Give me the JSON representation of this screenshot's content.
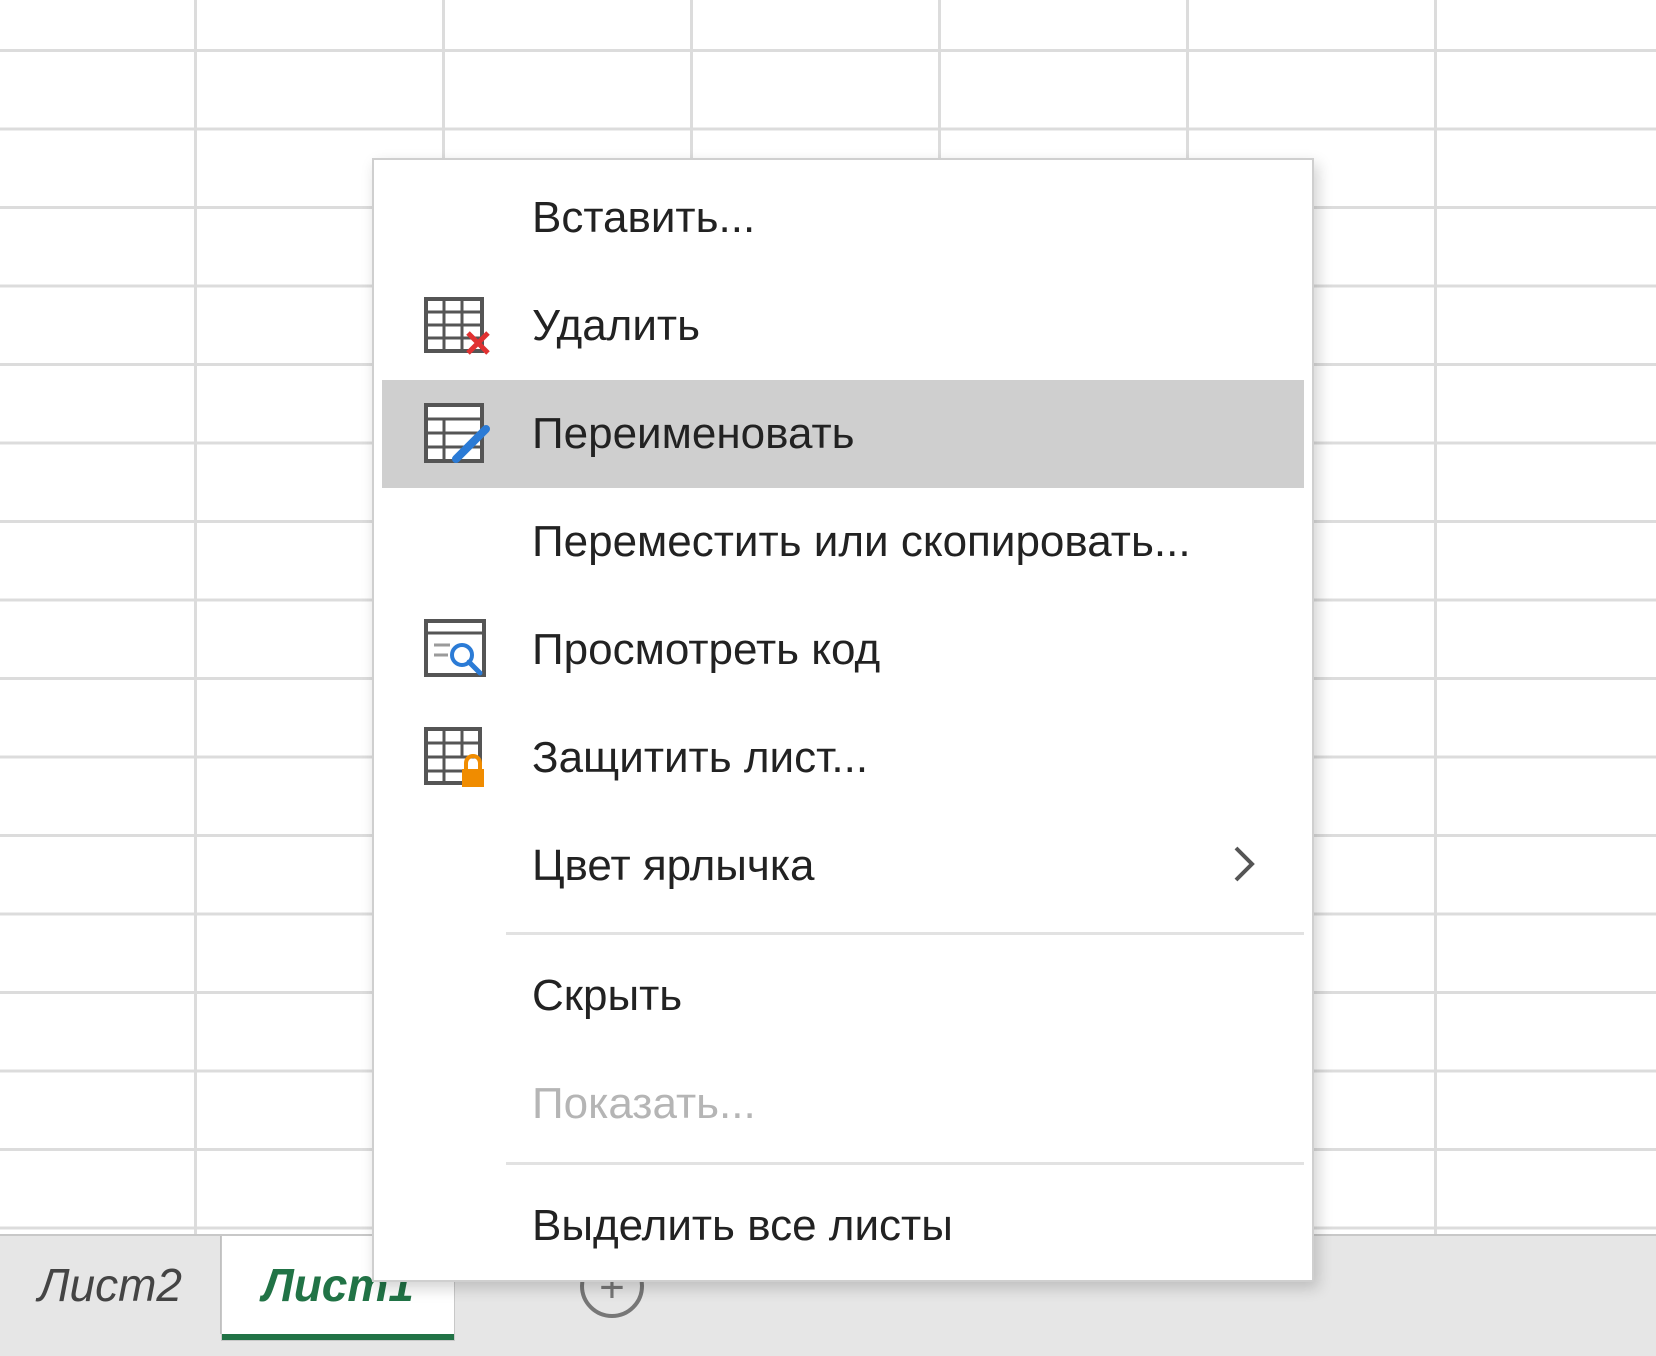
{
  "sheet_tabs": {
    "inactive_label": "Лист2",
    "active_label": "Лист1",
    "add_glyph": "+"
  },
  "context_menu": {
    "items": [
      {
        "label": "Вставить...",
        "icon": "none",
        "enabled": true
      },
      {
        "label": "Удалить",
        "icon": "delete-sheet-icon",
        "enabled": true
      },
      {
        "label": "Переименовать",
        "icon": "rename-sheet-icon",
        "enabled": true,
        "highlighted": true
      },
      {
        "label": "Переместить или скопировать...",
        "icon": "none",
        "enabled": true
      },
      {
        "label": "Просмотреть код",
        "icon": "view-code-icon",
        "enabled": true
      },
      {
        "label": "Защитить лист...",
        "icon": "protect-sheet-icon",
        "enabled": true
      },
      {
        "label": "Цвет ярлычка",
        "icon": "chevron-right-icon",
        "enabled": true,
        "submenu": true
      },
      {
        "label": "Скрыть",
        "icon": "none",
        "enabled": true
      },
      {
        "label": "Показать...",
        "icon": "none",
        "enabled": false
      },
      {
        "label": "Выделить все листы",
        "icon": "none",
        "enabled": true
      }
    ]
  },
  "colors": {
    "accent_green": "#217346",
    "highlight_gray": "#cfcfcf",
    "delete_red": "#e03131",
    "pencil_blue": "#2b7bd6",
    "lock_orange": "#f08c00"
  }
}
